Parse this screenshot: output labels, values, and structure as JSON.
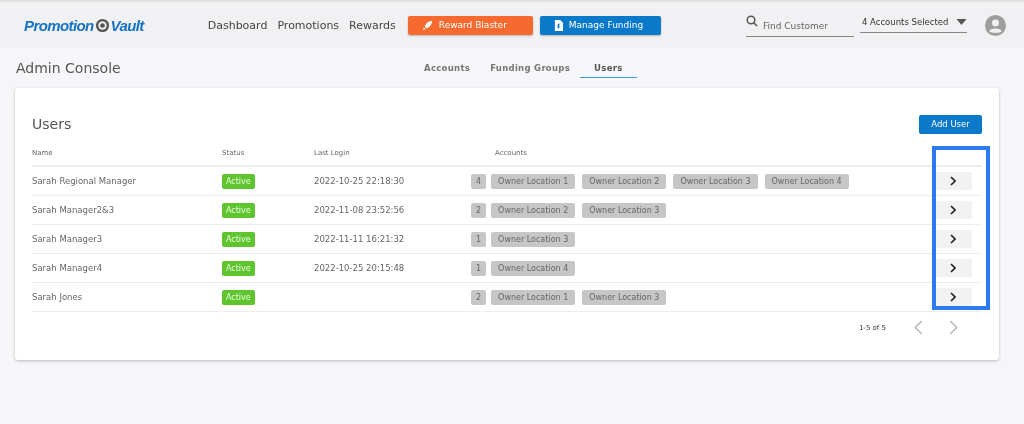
{
  "header": {
    "logo": {
      "left": "Promotion",
      "right": "Vault"
    },
    "nav": [
      "Dashboard",
      "Promotions",
      "Rewards"
    ],
    "buttons": [
      {
        "kind": "blaster",
        "label": "Reward Blaster"
      },
      {
        "kind": "funding",
        "label": "Manage Funding"
      }
    ],
    "search": {
      "placeholder": "Find Customer"
    },
    "account_select": {
      "value": "4 Accounts Selected"
    }
  },
  "page_title": "Admin Console",
  "tabs": [
    {
      "label": "Accounts",
      "selected": false
    },
    {
      "label": "Funding Groups",
      "selected": false
    },
    {
      "label": "Users",
      "selected": true
    }
  ],
  "card": {
    "title": "Users",
    "add_button": "Add User",
    "columns": [
      "Name",
      "Status",
      "Last Login",
      "Accounts"
    ],
    "rows": [
      {
        "name": "Sarah Regional Manager",
        "status": "Active",
        "last_login": "2022-10-25 22:18:30",
        "count": "4",
        "accounts": [
          "Owner Location 1",
          "Owner Location 2",
          "Owner Location 3",
          "Owner Location 4"
        ]
      },
      {
        "name": "Sarah Manager2&3",
        "status": "Active",
        "last_login": "2022-11-08 23:52:56",
        "count": "2",
        "accounts": [
          "Owner Location 2",
          "Owner Location 3"
        ]
      },
      {
        "name": "Sarah Manager3",
        "status": "Active",
        "last_login": "2022-11-11 16:21:32",
        "count": "1",
        "accounts": [
          "Owner Location 3"
        ]
      },
      {
        "name": "Sarah Manager4",
        "status": "Active",
        "last_login": "2022-10-25 20:15:48",
        "count": "1",
        "accounts": [
          "Owner Location 4"
        ]
      },
      {
        "name": "Sarah Jones",
        "status": "Active",
        "count": "2",
        "accounts": [
          "Owner Location 1",
          "Owner Location 3"
        ]
      }
    ],
    "pagination": "1-5 of 5"
  }
}
